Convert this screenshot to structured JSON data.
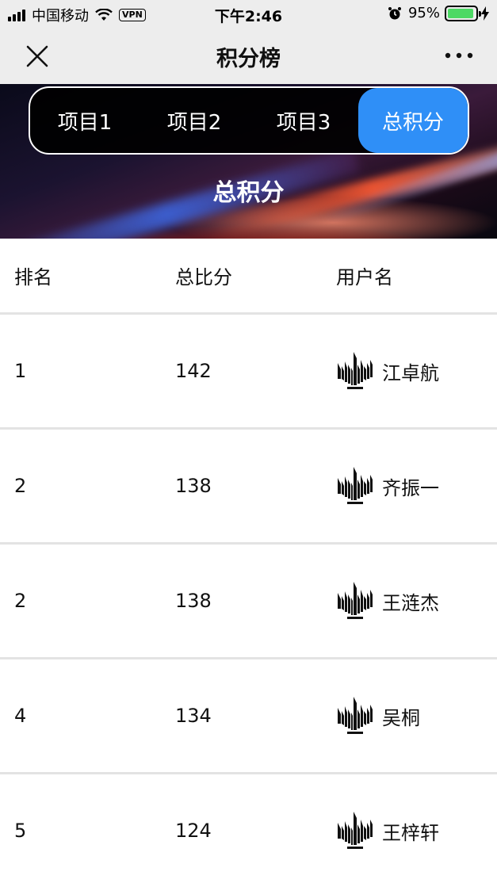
{
  "status_bar": {
    "carrier": "中国移动",
    "vpn": "VPN",
    "time": "下午2:46",
    "battery_percent": "95%",
    "battery_level": 0.95
  },
  "nav": {
    "title": "积分榜",
    "close_icon": "close-icon",
    "more_icon": "more-icon"
  },
  "tabs": [
    {
      "label": "项目1",
      "active": false
    },
    {
      "label": "项目2",
      "active": false
    },
    {
      "label": "项目3",
      "active": false
    },
    {
      "label": "总积分",
      "active": true
    }
  ],
  "banner": {
    "title": "总积分"
  },
  "table": {
    "headers": [
      "排名",
      "总比分",
      "用户名"
    ],
    "rows": [
      {
        "rank": "1",
        "score": "142",
        "name": "江卓航"
      },
      {
        "rank": "2",
        "score": "138",
        "name": "齐振一"
      },
      {
        "rank": "2",
        "score": "138",
        "name": "王涟杰"
      },
      {
        "rank": "4",
        "score": "134",
        "name": "吴桐"
      },
      {
        "rank": "5",
        "score": "124",
        "name": "王梓轩"
      }
    ]
  },
  "colors": {
    "accent": "#2f8ff7",
    "battery": "#4cd964"
  }
}
